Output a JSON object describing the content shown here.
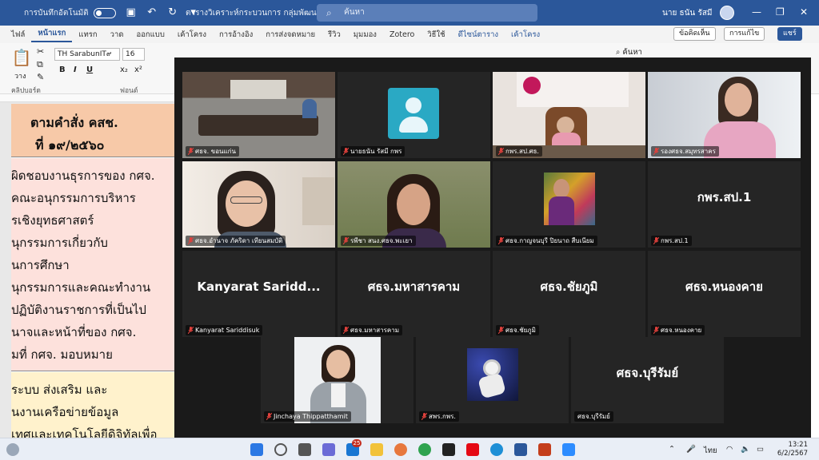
{
  "word": {
    "autosave_label": "การบันทึกอัตโนมัติ",
    "doc_title": "ตารางวิเคราะห์กระบวนการ กลุ่มพัฒนาบุ...",
    "search_placeholder": "ค้นหา",
    "user_name": "นาย ธนัน รัสมี",
    "tabs": [
      "ไฟล์",
      "หน้าแรก",
      "แทรก",
      "วาด",
      "ออกแบบ",
      "เค้าโครง",
      "การอ้างอิง",
      "การส่งจดหมาย",
      "รีวิว",
      "มุมมอง",
      "Zotero",
      "วิธีใช้",
      "ดีไซน์ตาราง",
      "เค้าโครง"
    ],
    "comment_button": "ข้อคิดเห็น",
    "editing_button": "การแก้ไข",
    "share_button": "แชร์",
    "font_name": "TH SarabunIT๙",
    "font_size": "16",
    "paste_label": "วาง",
    "clipboard_label": "คลิปบอร์ด",
    "font_group_label": "ฟอนต์",
    "find_label": "ค้นหา"
  },
  "document": {
    "heading_lines": [
      "ตามคำสั่ง คสช.",
      "ที่ ๑๙/๒๕๖๐"
    ],
    "body_lines": [
      "ผิดชอบงานธุรการของ กศจ.",
      "คณะอนุกรรมการบริหาร",
      "รเชิงยุทธศาสตร์",
      "นุกรรมการเกี่ยวกับ",
      "นการศึกษา",
      "นุกรรมการและคณะทำงาน",
      "ปฏิบัติงานราชการที่เป็นไป",
      "นาจและหน้าที่ของ กศจ.",
      "มที่ กศจ. มอบหมาย"
    ],
    "bottom_lines": [
      "ระบบ ส่งเสริม และ",
      "นงานเครือข่ายข้อมูล",
      "เทศและเทคโนโลยีดิจิทัลเพื่อ"
    ]
  },
  "zoom": {
    "tiles": [
      {
        "name": "ศธจ. ขอนแก่น",
        "kind": "video-office"
      },
      {
        "name": "นายธนัน รัสมี กพร",
        "kind": "avatar"
      },
      {
        "name": "กพร.สป.ศธ.",
        "kind": "video-desk",
        "active": true
      },
      {
        "name": "รองศธจ.สมุทรสาคร",
        "kind": "video-woman1"
      },
      {
        "name": "ศธจ.อำนาจ ภัคริดา เทียนสมบัติ",
        "kind": "video-woman2"
      },
      {
        "name": "รพีชา สนง.ศธจ.พะเยา",
        "kind": "video-woman3"
      },
      {
        "name": "ศธจ.กาญจนบุรี ปิยนาถ สืบเนียม",
        "kind": "photo-flowers"
      },
      {
        "name": "กพร.สป.1",
        "display": "กพร.สป.1",
        "kind": "text"
      },
      {
        "name": "Kanyarat Sariddisuk",
        "display": "Kanyarat  Saridd...",
        "kind": "text"
      },
      {
        "name": "ศธจ.มหาสารคาม",
        "display": "ศธจ.มหาสารคาม",
        "kind": "text"
      },
      {
        "name": "ศธจ.ชัยภูมิ",
        "display": "ศธจ.ชัยภูมิ",
        "kind": "text"
      },
      {
        "name": "ศธจ.หนองคาย",
        "display": "ศธจ.หนองคาย",
        "kind": "text"
      },
      {
        "name": "Jinchaya Thippatthamit",
        "kind": "photo-portrait"
      },
      {
        "name": "สพร.กพร.",
        "kind": "photo-astronaut"
      },
      {
        "name": "ศธจ.บุรีรัมย์",
        "display": "ศธจ.บุรีรัมย์",
        "kind": "text",
        "nomic": true
      }
    ]
  },
  "taskbar": {
    "mail_badge": "25",
    "language": "ไทย",
    "time": "13:21",
    "date": "6/2/2567"
  },
  "colors": {
    "word_blue": "#2b579a",
    "active_speaker": "#c8d95a"
  }
}
